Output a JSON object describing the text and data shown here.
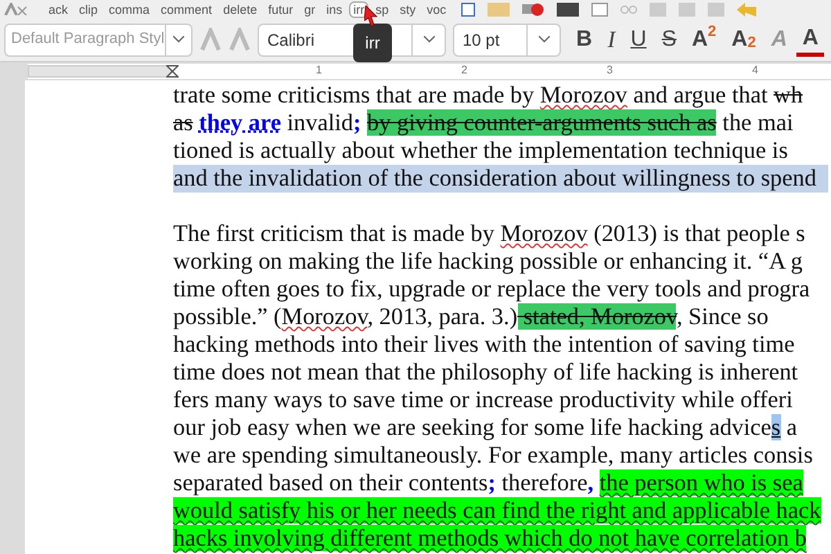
{
  "toolbar_top": {
    "items": [
      {
        "label": "ack",
        "selected": false
      },
      {
        "label": "clip",
        "selected": false
      },
      {
        "label": "comma",
        "selected": false
      },
      {
        "label": "comment",
        "selected": false
      },
      {
        "label": "delete",
        "selected": false
      },
      {
        "label": "futur",
        "selected": false
      },
      {
        "label": "gr",
        "selected": false
      },
      {
        "label": "ins",
        "selected": false
      },
      {
        "label": "irr",
        "selected": true
      },
      {
        "label": "sp",
        "selected": false
      },
      {
        "label": "sty",
        "selected": false
      },
      {
        "label": "voc",
        "selected": false
      }
    ]
  },
  "tooltip": "irr",
  "formatting_bar": {
    "paragraph_style": "Default Paragraph Styl",
    "font": "Calibri",
    "size": "10 pt",
    "buttons": [
      {
        "label": "B",
        "kind": "bold"
      },
      {
        "label": "I",
        "kind": "italic"
      },
      {
        "label": "U",
        "kind": "underline"
      },
      {
        "label": "S",
        "kind": "strike"
      },
      {
        "label": "A$^{2}$",
        "kind": "super"
      },
      {
        "label": "A$_{2}$",
        "kind": "sub"
      },
      {
        "label": "A",
        "kind": "clear"
      },
      {
        "label": "A",
        "kind": "color"
      }
    ]
  },
  "ruler": {
    "marks": [
      "1",
      "2",
      "3",
      "4"
    ]
  },
  "document": {
    "paragraphs": [
      {
        "lines": [
          {
            "selected": false,
            "segments": [
              {
                "kind": "plain",
                "text": "trate some criticisms that are made by "
              },
              {
                "kind": "misspelled",
                "text": "Morozov"
              },
              {
                "kind": "plain",
                "text": " and argue that "
              },
              {
                "kind": "struck",
                "text": "wh"
              }
            ]
          },
          {
            "selected": false,
            "segments": [
              {
                "kind": "struck",
                "text": "as"
              },
              {
                "kind": "inserted",
                "text": "they are",
                "space_before": true
              },
              {
                "kind": "plain",
                "text": " invalid"
              },
              {
                "kind": "inserted",
                "text": ";"
              },
              {
                "kind": "struck_highlight",
                "text": "by giving counter-arguments such as",
                "space_before": true
              },
              {
                "kind": "plain",
                "text": " the mai"
              }
            ]
          },
          {
            "selected": false,
            "segments": [
              {
                "kind": "plain",
                "text": "tioned is actually about whether the implementation technique is"
              }
            ]
          },
          {
            "selected": true,
            "segments": [
              {
                "kind": "plain",
                "text": "and the invalidation of the consideration about willingness to spend"
              }
            ]
          }
        ]
      },
      {
        "lines": [
          {
            "selected": false,
            "segments": [
              {
                "kind": "plain",
                "text": "The first criticism that is made by "
              },
              {
                "kind": "misspelled",
                "text": "Morozov"
              },
              {
                "kind": "plain",
                "text": " (2013) is that people s"
              }
            ]
          },
          {
            "selected": false,
            "segments": [
              {
                "kind": "plain",
                "text": "working on making the life hacking possible or enhancing it. “A g"
              }
            ]
          },
          {
            "selected": false,
            "segments": [
              {
                "kind": "plain",
                "text": "time often goes to fix, upgrade or replace the very tools and progra"
              }
            ]
          },
          {
            "selected": false,
            "segments": [
              {
                "kind": "plain",
                "text": "possible.” ("
              },
              {
                "kind": "misspelled",
                "text": "Morozov"
              },
              {
                "kind": "plain",
                "text": ", 2013, para. 3.)"
              },
              {
                "kind": "struck_highlight",
                "text": " stated, Morozov"
              },
              {
                "kind": "plain",
                "text": ", Since so"
              }
            ]
          },
          {
            "selected": false,
            "segments": [
              {
                "kind": "plain",
                "text": "hacking methods into their lives with the intention of saving time"
              }
            ]
          },
          {
            "selected": false,
            "segments": [
              {
                "kind": "plain",
                "text": "time does not mean that the philosophy of life hacking is inherent"
              }
            ]
          },
          {
            "selected": false,
            "segments": [
              {
                "kind": "plain",
                "text": "fers many ways to save time or increase productivity while offeri"
              }
            ]
          },
          {
            "selected": false,
            "segments": [
              {
                "kind": "plain",
                "text": "our job easy when we are seeking for some life hacking advice"
              },
              {
                "kind": "cursor",
                "text": "s"
              },
              {
                "kind": "plain",
                "text": " a"
              }
            ]
          },
          {
            "selected": false,
            "segments": [
              {
                "kind": "plain",
                "text": "we are spending simultaneously. For example, many articles consis"
              }
            ]
          },
          {
            "selected": false,
            "segments": [
              {
                "kind": "plain",
                "text": "separated based on their contents"
              },
              {
                "kind": "inserted",
                "text": ";"
              },
              {
                "kind": "plain",
                "text": " therefore"
              },
              {
                "kind": "inserted",
                "text": ","
              },
              {
                "kind": "highlight",
                "text": "the person who is sea",
                "space_before": true
              }
            ]
          },
          {
            "selected": false,
            "segments": [
              {
                "kind": "highlight",
                "text": "would satisfy his or her needs can find the right and applicable hack"
              }
            ]
          },
          {
            "selected": false,
            "segments": [
              {
                "kind": "highlight",
                "text": "hacks involving different methods which do not have correlation b"
              }
            ]
          }
        ]
      }
    ]
  }
}
